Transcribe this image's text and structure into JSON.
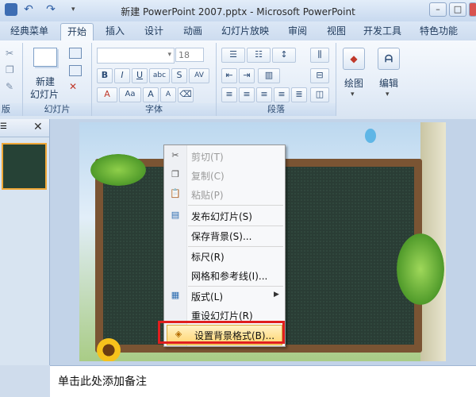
{
  "window": {
    "title": "新建 PowerPoint 2007.pptx - Microsoft PowerPoint"
  },
  "tabs": [
    "经典菜单",
    "开始",
    "插入",
    "设计",
    "动画",
    "幻灯片放映",
    "审阅",
    "视图",
    "开发工具",
    "特色功能"
  ],
  "ribbon": {
    "font_size": "18",
    "new_slide_label_1": "新建",
    "new_slide_label_2": "幻灯片",
    "drawing_label": "绘图",
    "editing_label": "编辑",
    "group_clipboard_partial": "版",
    "group_slides": "幻灯片",
    "group_font": "字体",
    "group_paragraph": "段落"
  },
  "context_menu": {
    "cut": "剪切(T)",
    "copy": "复制(C)",
    "paste": "粘贴(P)",
    "publish": "发布幻灯片(S)",
    "save_background": "保存背景(S)...",
    "ruler": "标尺(R)",
    "grid": "网格和参考线(I)...",
    "layout": "版式(L)",
    "reset": "重设幻灯片(R)",
    "format_background": "设置背景格式(B)..."
  },
  "notes": {
    "placeholder": "单击此处添加备注"
  },
  "colors": {
    "highlight": "#ffd56e",
    "callout": "#e01e1e",
    "board": "#2a3d35"
  }
}
